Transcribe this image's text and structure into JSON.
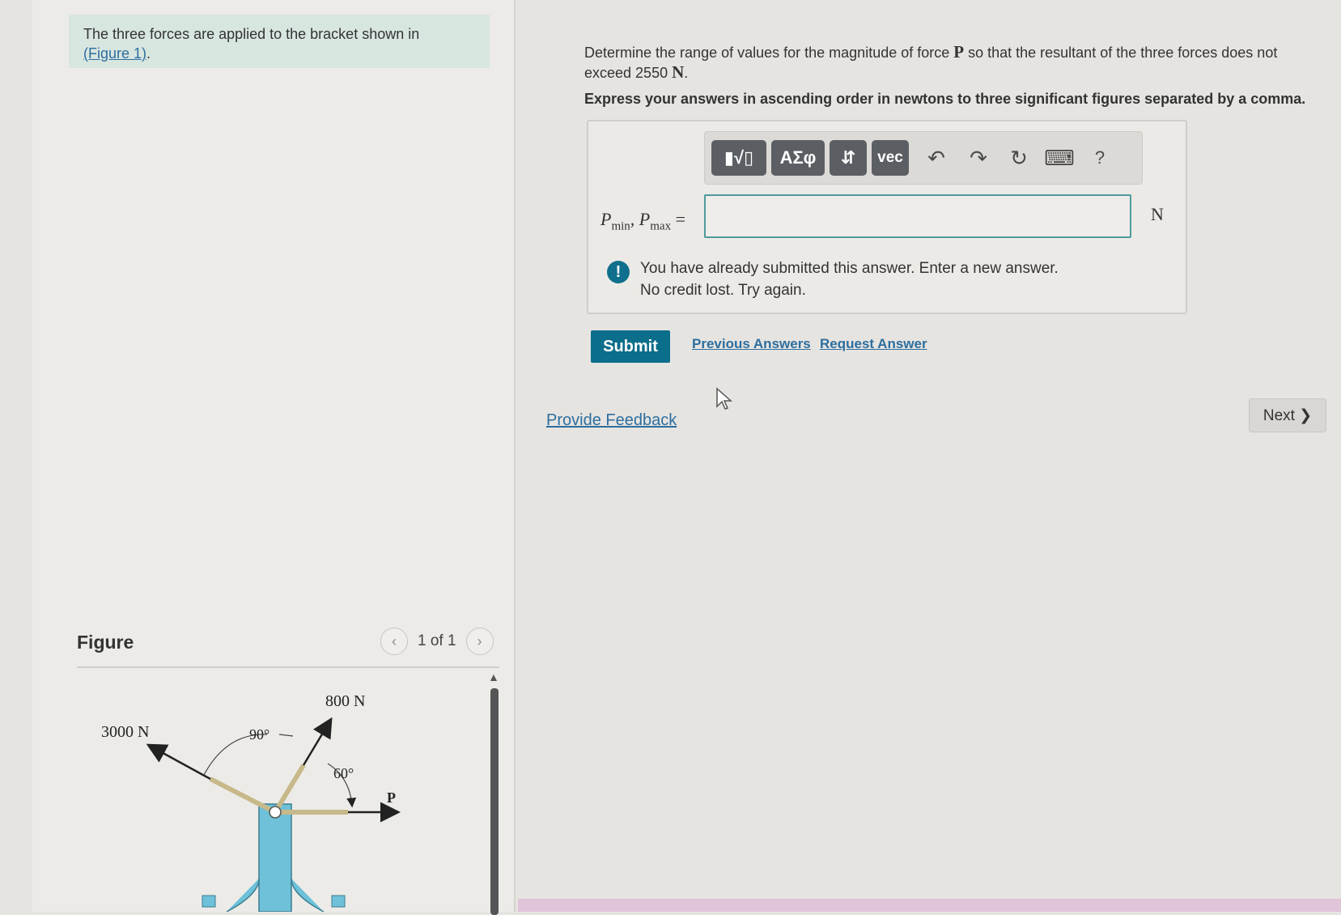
{
  "intro": {
    "text": "The three forces are applied to the bracket shown in",
    "figure_link": "(Figure 1)",
    "after_link": "."
  },
  "figure": {
    "title": "Figure",
    "count": "1 of 1",
    "labels": {
      "force_3000": "3000 N",
      "force_800": "800 N",
      "angle_90": "90°",
      "angle_60": "60°",
      "force_p": "P"
    }
  },
  "question": {
    "text_before": "Determine the range of values for the magnitude of force ",
    "force_symbol": "P",
    "text_after": " so that the resultant of the three forces does not exceed 2550 ",
    "unit_symbol": "N",
    "end": ".",
    "instruction": "Express your answers in ascending order in newtons to three significant figures separated by a comma."
  },
  "toolbar": {
    "templates_label": "▮√▯",
    "greek_label": "ΑΣφ",
    "updown_label": "⇵",
    "vec_label": "vec",
    "undo_icon": "↶",
    "redo_icon": "↷",
    "reset_icon": "↻",
    "keyboard_icon": "⌨",
    "help_label": "?"
  },
  "answer": {
    "p": "P",
    "min_sub": "min",
    "max_sub": "max",
    "sep": ", ",
    "eq": " =",
    "value": "",
    "unit": "N"
  },
  "alert": {
    "icon": "!",
    "line1": "You have already submitted this answer. Enter a new answer.",
    "line2": "No credit lost. Try again."
  },
  "actions": {
    "submit": "Submit",
    "previous_answers": "Previous Answers",
    "request_answer": "Request Answer",
    "provide_feedback": "Provide Feedback",
    "next": "Next ❯"
  },
  "colors": {
    "primary": "#0b6e8b",
    "link": "#2d6e9e",
    "intro_bg": "#d8e6e0",
    "bracket": "#6ec1d8"
  }
}
